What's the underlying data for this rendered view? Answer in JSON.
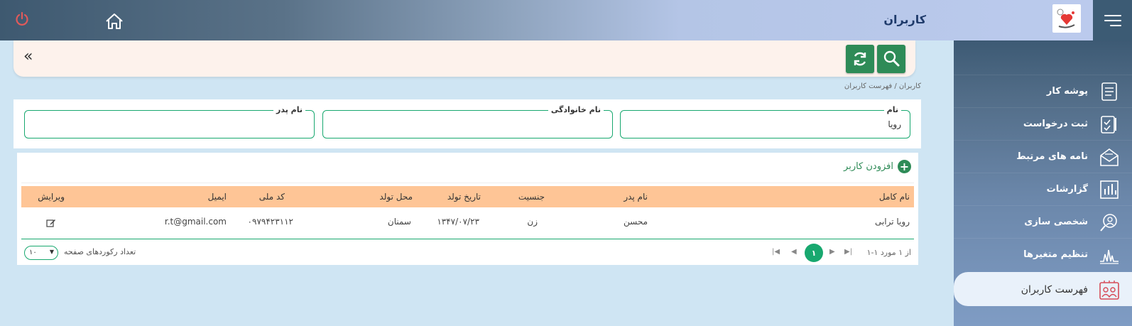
{
  "header": {
    "title": "کاربران"
  },
  "sidebar": {
    "items": [
      {
        "label": "پوشه کار",
        "icon": "folder-icon"
      },
      {
        "label": "ثبت درخواست",
        "icon": "request-form-icon"
      },
      {
        "label": "نامه های مرتبط",
        "icon": "letters-icon"
      },
      {
        "label": "گزارشات",
        "icon": "bar-chart-icon"
      },
      {
        "label": "شخصی سازی",
        "icon": "user-profile-icon"
      },
      {
        "label": "تنظیم متغیرها",
        "icon": "variables-icon"
      },
      {
        "label": "فهرست کاربران",
        "icon": "user-list-icon"
      }
    ]
  },
  "breadcrumb": "کاربران / فهرست کاربران",
  "search": {
    "first_name_label": "نام",
    "first_name_value": "رویا",
    "last_name_label": "نام خانوادگی",
    "last_name_value": "",
    "father_name_label": "نام پدر",
    "father_name_value": ""
  },
  "table": {
    "add_label": "افزودن کاربر",
    "columns": {
      "full_name": "نام کامل",
      "father_name": "نام پدر",
      "gender": "جنسیت",
      "birth_date": "تاریخ تولد",
      "birth_place": "محل تولد",
      "national_code": "کد ملی",
      "email": "ایمیل",
      "edit": "ویرایش"
    },
    "rows": [
      {
        "full_name": "رویا ترابی",
        "father_name": "محسن",
        "gender": "زن",
        "birth_date": "۱۳۴۷/۰۷/۲۳",
        "birth_place": "سمنان",
        "national_code": "۰۹۷۹۴۲۳۱۱۲",
        "email": "r.t@gmail.com"
      }
    ]
  },
  "pagination": {
    "summary": "۱-۱ از ۱ مورد",
    "current_page": "۱",
    "page_size_label": "تعداد رکوردهای صفحه",
    "page_size": "۱۰"
  },
  "colors": {
    "accent": "#18a86f",
    "button": "#2e8b57",
    "table_header": "#fec596",
    "power": "#e05a5a"
  }
}
